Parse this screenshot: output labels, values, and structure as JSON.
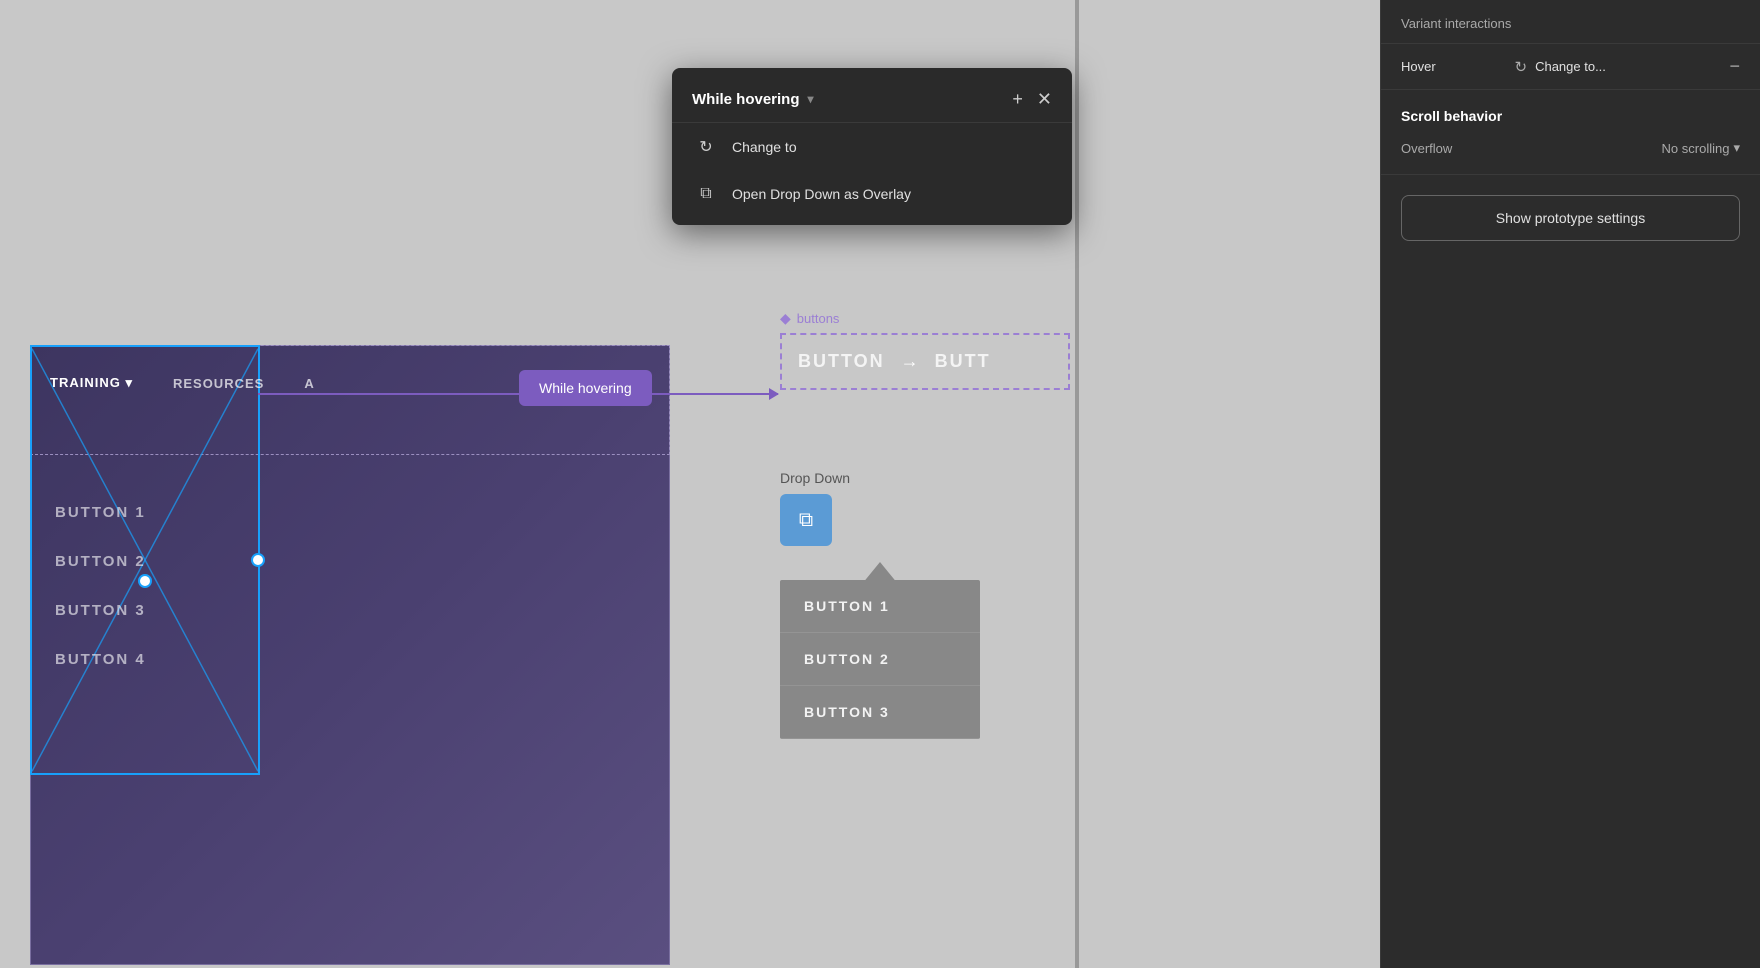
{
  "panel": {
    "variant_interactions_label": "Variant interactions",
    "hover_label": "Hover",
    "change_to_label": "Change to...",
    "scroll_behavior_title": "Scroll behavior",
    "overflow_label": "Overflow",
    "no_scrolling_label": "No scrolling",
    "show_prototype_btn": "Show prototype settings"
  },
  "popup": {
    "title": "While hovering",
    "add_icon": "+",
    "close_icon": "✕",
    "items": [
      {
        "icon": "↻",
        "label": "Change to"
      },
      {
        "icon": "⧉",
        "label": "Open Drop Down as Overlay"
      }
    ]
  },
  "canvas": {
    "hover_bubble": "While hovering",
    "buttons_label": "buttons",
    "button_text_1": "BUTTON",
    "button_text_2": "BUTT",
    "dropdown_label": "Drop Down",
    "nav_items": [
      "TRAINING ▾",
      "RESOURCES",
      "A"
    ],
    "button_list": [
      "BUTTON 1",
      "BUTTON 2",
      "BUTTON 3",
      "BUTTON 4"
    ],
    "gray_buttons": [
      "BUTTON 1",
      "BUTTON 2",
      "BUTTON 3"
    ]
  }
}
